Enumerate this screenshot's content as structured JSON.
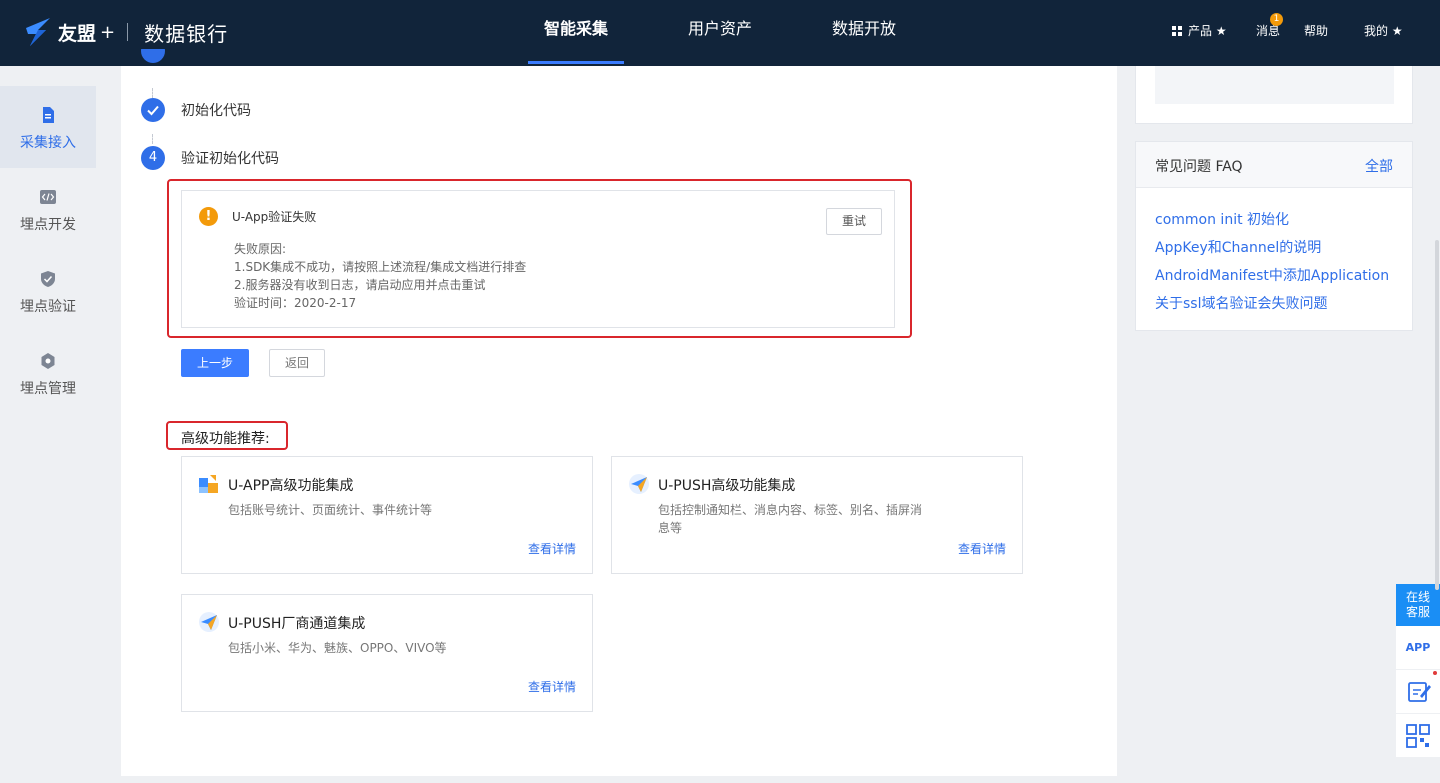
{
  "header": {
    "brand": "友盟",
    "brand_plus": "+",
    "product": "数据银行",
    "nav": [
      {
        "label": "智能采集",
        "active": true
      },
      {
        "label": "用户资产",
        "active": false
      },
      {
        "label": "数据开放",
        "active": false
      }
    ],
    "right": {
      "products": "产品 ★",
      "messages": "消息",
      "message_badge": "1",
      "help": "帮助",
      "mine": "我的 ★"
    }
  },
  "sidebar": {
    "items": [
      {
        "label": "采集接入",
        "icon": "document-icon",
        "active": true
      },
      {
        "label": "埋点开发",
        "icon": "code-icon",
        "active": false
      },
      {
        "label": "埋点验证",
        "icon": "shield-check-icon",
        "active": false
      },
      {
        "label": "埋点管理",
        "icon": "gear-icon",
        "active": false
      }
    ]
  },
  "steps": {
    "step2_label": "初始化代码",
    "step4_number": "4",
    "step4_label": "验证初始化代码"
  },
  "verify_result": {
    "title": "U-App验证失败",
    "reason_label": "失败原因:",
    "reason_1": "1.SDK集成不成功，请按照上述流程/集成文档进行排查",
    "reason_2": "2.服务器没有收到日志，请启动应用并点击重试",
    "verify_time": "验证时间：2020-2-17",
    "retry_label": "重试"
  },
  "actions": {
    "prev_label": "上一步",
    "back_label": "返回"
  },
  "advanced": {
    "title": "高级功能推荐:",
    "cards": [
      {
        "title": "U-APP高级功能集成",
        "desc": "包括账号统计、页面统计、事件统计等",
        "link": "查看详情"
      },
      {
        "title": "U-PUSH高级功能集成",
        "desc": "包括控制通知栏、消息内容、标签、别名、插屏消息等",
        "link": "查看详情"
      },
      {
        "title": "U-PUSH厂商通道集成",
        "desc": "包括小米、华为、魅族、OPPO、VIVO等",
        "link": "查看详情"
      }
    ]
  },
  "faq": {
    "title": "常见问题 FAQ",
    "all_label": "全部",
    "links": [
      "common init 初始化",
      "AppKey和Channel的说明",
      "AndroidManifest中添加Application",
      "关于ssl域名验证会失败问题"
    ]
  },
  "float_tools": {
    "customer_service": "在线客服",
    "app_label": "APP"
  },
  "colors": {
    "header_bg": "#11243a",
    "accent": "#2f6ee8",
    "warning": "#f39a0a",
    "highlight_border": "#d9262c"
  }
}
